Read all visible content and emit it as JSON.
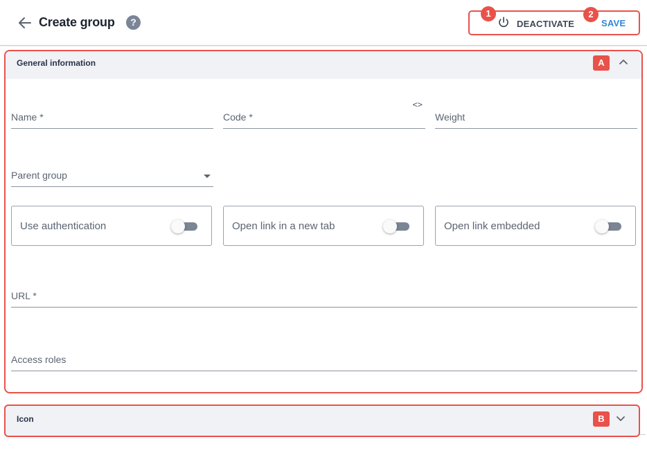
{
  "header": {
    "title": "Create group",
    "help_symbol": "?",
    "back_icon": "arrow-left-icon",
    "deactivate_label": "DEACTIVATE",
    "deactivate_icon": "power-icon",
    "save_label": "SAVE"
  },
  "annotations": {
    "badge_1": "1",
    "badge_2": "2",
    "badge_a": "A",
    "badge_b": "B",
    "color": "#e8524a"
  },
  "general": {
    "title": "General information",
    "expanded": true,
    "fields": {
      "name": "Name *",
      "code": "Code *",
      "code_icon": "<>",
      "weight": "Weight",
      "parent_group": "Parent group",
      "url": "URL *",
      "access_roles": "Access roles"
    },
    "toggles": [
      {
        "label": "Use authentication",
        "on": false
      },
      {
        "label": "Open link in a new tab",
        "on": false
      },
      {
        "label": "Open link embedded",
        "on": false
      }
    ]
  },
  "icon_section": {
    "title": "Icon",
    "expanded": false
  },
  "colors": {
    "accent": "#2f88d6",
    "annotation": "#e8524a",
    "section_header_bg": "#f1f2f5"
  }
}
